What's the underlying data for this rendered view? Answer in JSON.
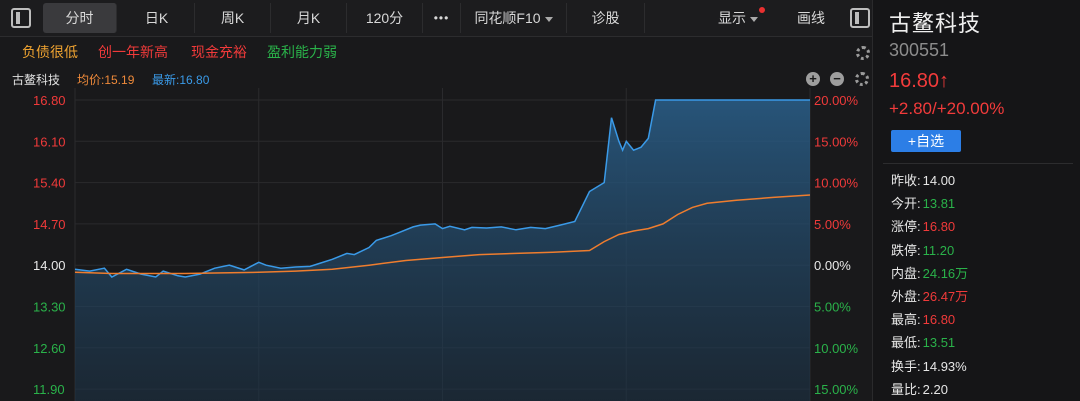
{
  "toolbar": {
    "tabs": [
      "分时",
      "日K",
      "周K",
      "月K",
      "120分"
    ],
    "more": "•••",
    "f10": "同花顺F10",
    "diagnose": "诊股",
    "display": "显示",
    "draw": "画线"
  },
  "tags": [
    {
      "text": "负债很低",
      "color": "#f0a431"
    },
    {
      "text": "创一年新高",
      "color": "#f03a3a"
    },
    {
      "text": "现金充裕",
      "color": "#f03a3a"
    },
    {
      "text": "盈利能力弱",
      "color": "#2ab24a"
    }
  ],
  "info": {
    "name": "古鳌科技",
    "avg": "均价:15.19",
    "latest": "最新:16.80"
  },
  "chart_data": {
    "type": "line",
    "y_price_ticks": [
      "16.80",
      "16.10",
      "15.40",
      "14.70",
      "14.00",
      "13.30",
      "12.60",
      "11.90"
    ],
    "y_pct_ticks": [
      "20.00%",
      "15.00%",
      "10.00%",
      "5.00%",
      "0.00%",
      "5.00%",
      "10.00%",
      "15.00%"
    ],
    "ylim": [
      11.9,
      16.8
    ],
    "prev_close": 14.0,
    "series": [
      {
        "color": "#3a9ae8",
        "x": [
          0,
          0.02,
          0.04,
          0.05,
          0.07,
          0.09,
          0.11,
          0.12,
          0.14,
          0.15,
          0.17,
          0.19,
          0.21,
          0.23,
          0.25,
          0.26,
          0.28,
          0.3,
          0.32,
          0.33,
          0.35,
          0.37,
          0.38,
          0.4,
          0.41,
          0.43,
          0.44,
          0.46,
          0.47,
          0.49,
          0.5,
          0.51,
          0.53,
          0.54,
          0.56,
          0.58,
          0.6,
          0.62,
          0.64,
          0.66,
          0.68,
          0.7,
          0.72,
          0.73,
          0.74,
          0.745,
          0.75,
          0.76,
          0.77,
          0.78,
          0.79,
          0.8,
          0.81,
          0.82,
          0.83,
          0.85,
          0.88,
          0.92,
          0.96,
          1.0
        ],
        "values": [
          13.93,
          13.9,
          13.95,
          13.8,
          13.93,
          13.85,
          13.8,
          13.9,
          13.82,
          13.8,
          13.85,
          13.95,
          14.0,
          13.92,
          14.05,
          14.0,
          13.95,
          13.97,
          13.98,
          14.02,
          14.1,
          14.2,
          14.18,
          14.3,
          14.42,
          14.5,
          14.55,
          14.65,
          14.68,
          14.7,
          14.62,
          14.66,
          14.6,
          14.64,
          14.63,
          14.65,
          14.6,
          14.64,
          14.62,
          14.68,
          14.74,
          15.25,
          15.4,
          16.5,
          16.1,
          15.95,
          16.1,
          15.95,
          16.0,
          16.15,
          16.8,
          16.8,
          16.8,
          16.8,
          16.8,
          16.8,
          16.8,
          16.8,
          16.8,
          16.8
        ]
      },
      {
        "color": "#ef7d2e",
        "x": [
          0,
          0.05,
          0.1,
          0.15,
          0.2,
          0.25,
          0.3,
          0.35,
          0.4,
          0.45,
          0.5,
          0.55,
          0.6,
          0.65,
          0.7,
          0.72,
          0.74,
          0.76,
          0.78,
          0.8,
          0.82,
          0.84,
          0.86,
          0.9,
          0.95,
          1.0
        ],
        "values": [
          13.88,
          13.86,
          13.86,
          13.86,
          13.87,
          13.88,
          13.9,
          13.93,
          14.0,
          14.08,
          14.13,
          14.18,
          14.2,
          14.22,
          14.25,
          14.4,
          14.52,
          14.58,
          14.62,
          14.7,
          14.86,
          14.98,
          15.05,
          15.1,
          15.15,
          15.19
        ]
      }
    ]
  },
  "stock": {
    "name": "古鳌科技",
    "code": "300551",
    "price": "16.80↑",
    "change": "+2.80/+20.00%",
    "add_watch": "+自选"
  },
  "stats": [
    {
      "label": "昨收:",
      "value": "14.00",
      "color": "#e6e6e6"
    },
    {
      "label": "今开:",
      "value": "13.81",
      "color": "#2ab24a"
    },
    {
      "label": "涨停:",
      "value": "16.80",
      "color": "#f03a3a"
    },
    {
      "label": "跌停:",
      "value": "11.20",
      "color": "#2ab24a"
    },
    {
      "label": "内盘:",
      "value": "24.16万",
      "color": "#2ab24a"
    },
    {
      "label": "外盘:",
      "value": "26.47万",
      "color": "#f03a3a"
    },
    {
      "label": "最高:",
      "value": "16.80",
      "color": "#f03a3a"
    },
    {
      "label": "最低:",
      "value": "13.51",
      "color": "#2ab24a"
    },
    {
      "label": "换手:",
      "value": "14.93%",
      "color": "#e6e6e6"
    },
    {
      "label": "量比:",
      "value": "2.20",
      "color": "#e6e6e6"
    }
  ]
}
